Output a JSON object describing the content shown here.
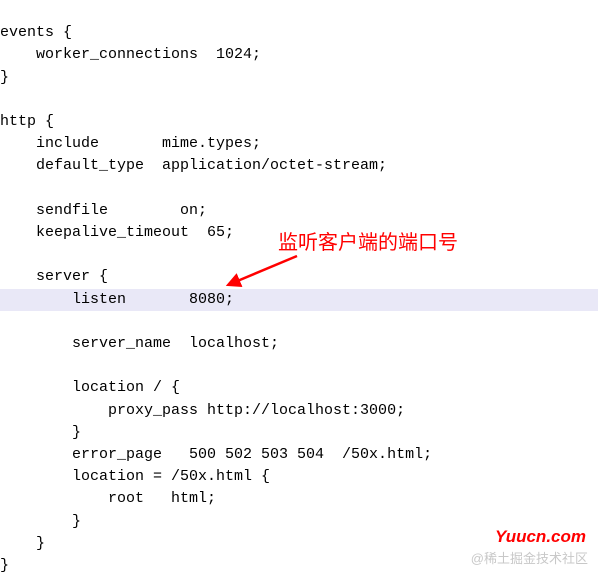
{
  "code": {
    "l1": "events {",
    "l2": "    worker_connections  1024;",
    "l3": "}",
    "l4": "",
    "l5": "http {",
    "l6": "    include       mime.types;",
    "l7": "    default_type  application/octet-stream;",
    "l8": "",
    "l9": "    sendfile        on;",
    "l10": "    keepalive_timeout  65;",
    "l11": "",
    "l12": "    server {",
    "l13": "        listen       8080;",
    "l14": "        server_name  localhost;",
    "l15": "",
    "l16": "        location / {",
    "l17": "            proxy_pass http://localhost:3000;",
    "l18": "        }",
    "l19": "        error_page   500 502 503 504  /50x.html;",
    "l20": "        location = /50x.html {",
    "l21": "            root   html;",
    "l22": "        }",
    "l23": "    }",
    "l24": "}"
  },
  "annotation_text": "监听客户端的端口号",
  "watermark_red": "Yuucn.com",
  "watermark_grey": "@稀土掘金技术社区"
}
